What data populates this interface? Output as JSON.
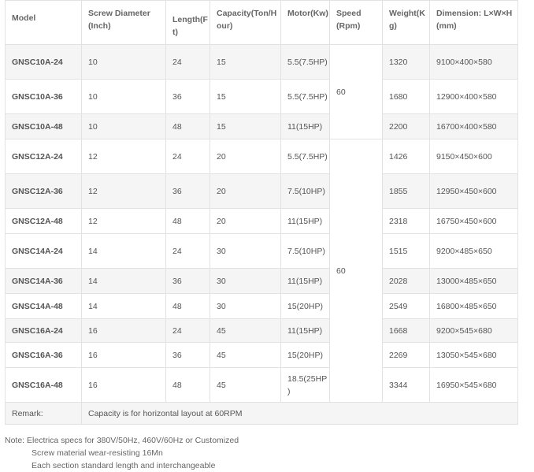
{
  "headers": {
    "model": "Model",
    "screw": "Screw Diameter (Inch)",
    "length": "Length(Ft)",
    "capacity": "Capacity(Ton/Hour)",
    "motor": "Motor(Kw)",
    "speed": "Speed (Rpm)",
    "weight": "Weight(Kg)",
    "dimension": "Dimension: L×W×H (mm)"
  },
  "speed_groups": [
    "60",
    "60"
  ],
  "rows": [
    {
      "model": "GNSC10A-24",
      "screw": "10",
      "length": "24",
      "capacity": "15",
      "motor": "5.5(7.5HP)",
      "weight": "1320",
      "dimension": "9100×400×580"
    },
    {
      "model": "GNSC10A-36",
      "screw": "10",
      "length": "36",
      "capacity": "15",
      "motor": "5.5(7.5HP)",
      "weight": "1680",
      "dimension": "12900×400×580"
    },
    {
      "model": "GNSC10A-48",
      "screw": "10",
      "length": "48",
      "capacity": "15",
      "motor": "11(15HP)",
      "weight": "2200",
      "dimension": "16700×400×580"
    },
    {
      "model": "GNSC12A-24",
      "screw": "12",
      "length": "24",
      "capacity": "20",
      "motor": "5.5(7.5HP)",
      "weight": "1426",
      "dimension": "9150×450×600"
    },
    {
      "model": "GNSC12A-36",
      "screw": "12",
      "length": "36",
      "capacity": "20",
      "motor": "7.5(10HP)",
      "weight": "1855",
      "dimension": "12950×450×600"
    },
    {
      "model": "GNSC12A-48",
      "screw": "12",
      "length": "48",
      "capacity": "20",
      "motor": "11(15HP)",
      "weight": "2318",
      "dimension": "16750×450×600"
    },
    {
      "model": "GNSC14A-24",
      "screw": "14",
      "length": "24",
      "capacity": "30",
      "motor": "7.5(10HP)",
      "weight": "1515",
      "dimension": "9200×485×650"
    },
    {
      "model": "GNSC14A-36",
      "screw": "14",
      "length": "36",
      "capacity": "30",
      "motor": "11(15HP)",
      "weight": "2028",
      "dimension": "13000×485×650"
    },
    {
      "model": "GNSC14A-48",
      "screw": "14",
      "length": "48",
      "capacity": "30",
      "motor": "15(20HP)",
      "weight": "2549",
      "dimension": "16800×485×650"
    },
    {
      "model": "GNSC16A-24",
      "screw": "16",
      "length": "24",
      "capacity": "45",
      "motor": "11(15HP)",
      "weight": "1668",
      "dimension": "9200×545×680"
    },
    {
      "model": "GNSC16A-36",
      "screw": "16",
      "length": "36",
      "capacity": "45",
      "motor": "15(20HP)",
      "weight": "2269",
      "dimension": "13050×545×680"
    },
    {
      "model": "GNSC16A-48",
      "screw": "16",
      "length": "48",
      "capacity": "45",
      "motor": "18.5(25HP)",
      "weight": "3344",
      "dimension": "16950×545×680"
    }
  ],
  "remark": {
    "label": "Remark:",
    "text": "Capacity is for horizontal layout at 60RPM"
  },
  "notes": [
    "Note: Electrica specs for 380V/50Hz, 460V/60Hz or Customized",
    "Screw material wear-resisting 16Mn",
    "Each section standard length and interchangeable"
  ]
}
